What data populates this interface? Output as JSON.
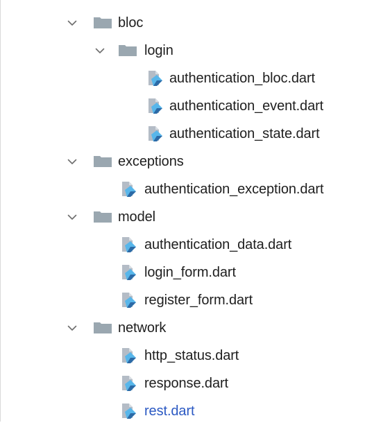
{
  "tree": {
    "items": [
      {
        "type": "folder",
        "level": 0,
        "name": "bloc",
        "expanded": true
      },
      {
        "type": "folder",
        "level": 1,
        "name": "login",
        "expanded": true
      },
      {
        "type": "file",
        "level": 2,
        "name": "authentication_bloc.dart"
      },
      {
        "type": "file",
        "level": 2,
        "name": "authentication_event.dart"
      },
      {
        "type": "file",
        "level": 2,
        "name": "authentication_state.dart"
      },
      {
        "type": "folder",
        "level": 0,
        "name": "exceptions",
        "expanded": true
      },
      {
        "type": "file",
        "level": 1,
        "name": "authentication_exception.dart"
      },
      {
        "type": "folder",
        "level": 0,
        "name": "model",
        "expanded": true
      },
      {
        "type": "file",
        "level": 1,
        "name": "authentication_data.dart"
      },
      {
        "type": "file",
        "level": 1,
        "name": "login_form.dart"
      },
      {
        "type": "file",
        "level": 1,
        "name": "register_form.dart"
      },
      {
        "type": "folder",
        "level": 0,
        "name": "network",
        "expanded": true
      },
      {
        "type": "file",
        "level": 1,
        "name": "http_status.dart"
      },
      {
        "type": "file",
        "level": 1,
        "name": "response.dart"
      },
      {
        "type": "file",
        "level": 1,
        "name": "rest.dart",
        "modified": true
      }
    ]
  },
  "colors": {
    "folder": "#9aa7b0",
    "chevron": "#6e6e6e",
    "text": "#1e1e1e",
    "modified_text": "#2b59c3",
    "dart_dark": "#2c6aa6",
    "dart_light": "#58b6ea",
    "file_grey": "#b4bcc6"
  },
  "icons": {
    "chevron": "chevron-down-icon",
    "folder": "folder-icon",
    "file": "dart-file-icon"
  }
}
